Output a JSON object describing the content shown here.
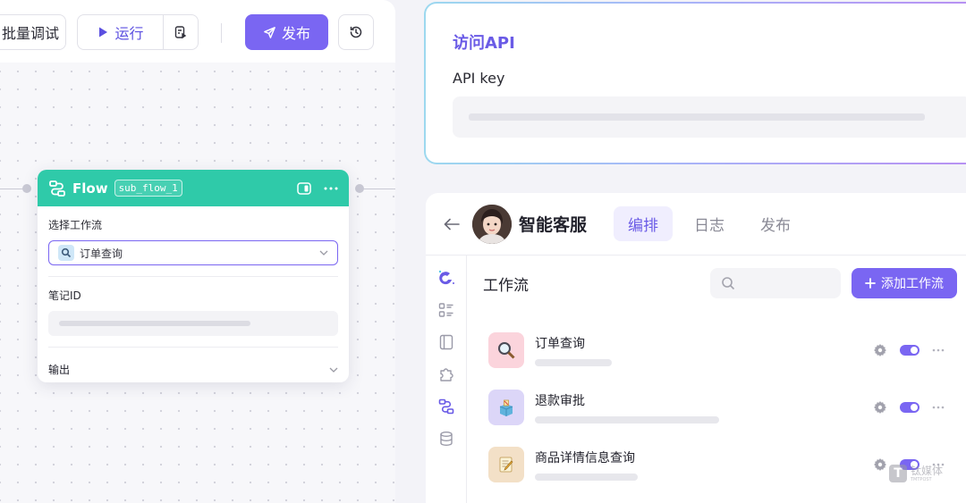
{
  "toolbar": {
    "batch_debug_label": "批量调试",
    "batch_debug_visible": "批量调试",
    "run_label": "运行",
    "publish_label": "发布"
  },
  "flow_node": {
    "title": "Flow",
    "tag": "sub_flow_1",
    "select_workflow_label": "选择工作流",
    "selected_workflow": "订单查询",
    "note_id_label": "笔记ID",
    "output_label": "输出"
  },
  "api_card": {
    "title": "访问API",
    "api_key_label": "API key"
  },
  "agent": {
    "name": "智能客服",
    "tabs": [
      {
        "label": "编排",
        "active": true
      },
      {
        "label": "日志",
        "active": false
      },
      {
        "label": "发布",
        "active": false
      }
    ],
    "workflow_section_title": "工作流",
    "add_workflow_label": "添加工作流",
    "workflows": [
      {
        "name": "订单查询",
        "icon": "magnifier-icon",
        "icon_bg": "#fbd4dc",
        "enabled": true,
        "desc_fraction": 0.42
      },
      {
        "name": "退款审批",
        "icon": "ballot-box-icon",
        "icon_bg": "#dcd6f8",
        "enabled": true,
        "desc_fraction": 1.0
      },
      {
        "name": "商品详情信息查询",
        "icon": "memo-icon",
        "icon_bg": "#f3e0c7",
        "enabled": true,
        "desc_fraction": 0.56
      }
    ]
  },
  "colors": {
    "accent": "#7a66f2",
    "flow_header": "#2fcaa9",
    "api_title": "#6a5be6"
  },
  "watermark": {
    "cn": "钛媒体",
    "en": "TMTPOST"
  }
}
